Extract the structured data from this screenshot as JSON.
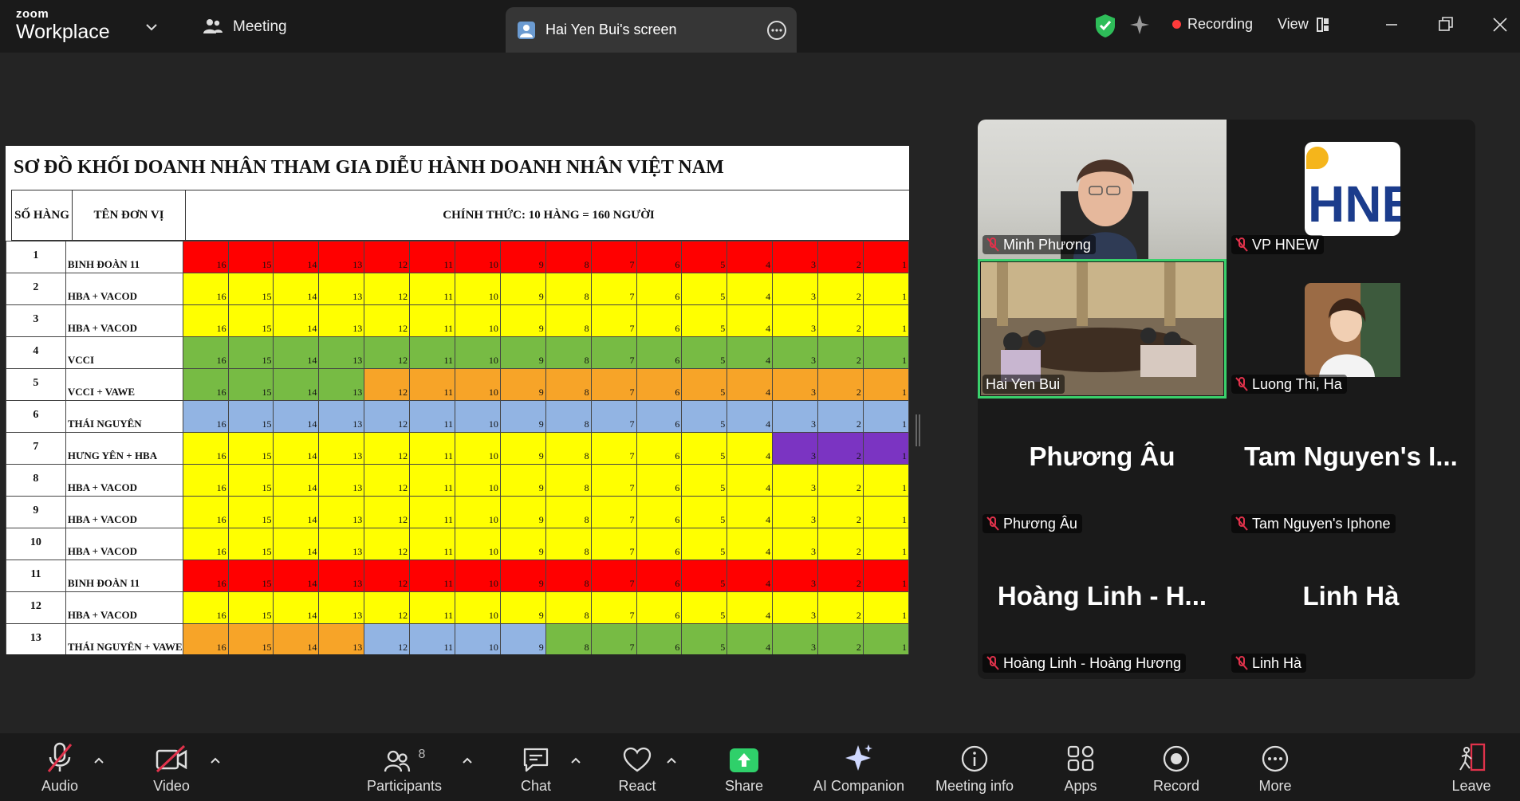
{
  "app": {
    "logo_line1": "zoom",
    "logo_line2": "Workplace"
  },
  "topbar": {
    "meeting_label": "Meeting",
    "share_tab_label": "Hai Yen Bui's screen",
    "recording_label": "Recording",
    "view_label": "View",
    "colors": {
      "bar": "#1a1a1a",
      "recording_dot": "#ff3b3b",
      "shield": "#2ebd59"
    }
  },
  "sheet": {
    "title": "SƠ ĐỒ KHỐI DOANH NHÂN THAM GIA DIỄU HÀNH DOANH NHÂN VIỆT NAM",
    "col_row_header": "SỐ HÀNG",
    "col_unit_header": "TÊN ĐƠN VỊ",
    "main_header": "CHÍNH THỨC: 10 HÀNG = 160 NGƯỜI",
    "palette": {
      "R": "#ff0000",
      "Y": "#ffff00",
      "G": "#77bb44",
      "O": "#f7a428",
      "B": "#92b4e3",
      "P": "#7b34c2"
    },
    "rows": [
      {
        "n": "1",
        "unit": "BINH ĐOÀN 11",
        "colors": "RRRRRRRRRRRRRRRR"
      },
      {
        "n": "2",
        "unit": "HBA + VACOD",
        "colors": "YYYYYYYYYYYYYYYY"
      },
      {
        "n": "3",
        "unit": "HBA + VACOD",
        "colors": "YYYYYYYYYYYYYYYY"
      },
      {
        "n": "4",
        "unit": "VCCI",
        "colors": "GGGGGGGGGGGGGGGG"
      },
      {
        "n": "5",
        "unit": "VCCI + VAWE",
        "colors": "GGGGOOOOOOOOOOOO"
      },
      {
        "n": "6",
        "unit": "THÁI NGUYÊN",
        "colors": "BBBBBBBBBBBBBBBB"
      },
      {
        "n": "7",
        "unit": "HƯNG YÊN + HBA",
        "colors": "YYYYYYYYYYYYYPPP"
      },
      {
        "n": "8",
        "unit": "HBA + VACOD",
        "colors": "YYYYYYYYYYYYYYYY"
      },
      {
        "n": "9",
        "unit": "HBA + VACOD",
        "colors": "YYYYYYYYYYYYYYYY"
      },
      {
        "n": "10",
        "unit": "HBA + VACOD",
        "colors": "YYYYYYYYYYYYYYYY"
      },
      {
        "n": "11",
        "unit": "BINH ĐOÀN 11",
        "colors": "RRRRRRRRRRRRRRRR"
      },
      {
        "n": "12",
        "unit": "HBA + VACOD",
        "colors": "YYYYYYYYYYYYYYYY"
      },
      {
        "n": "13",
        "unit": "THÁI NGUYÊN + VAWE",
        "colors": "OOOOBBBBGGGGGGGG"
      }
    ],
    "positions": [
      "16",
      "15",
      "14",
      "13",
      "12",
      "11",
      "10",
      "9",
      "8",
      "7",
      "6",
      "5",
      "4",
      "3",
      "2",
      "1"
    ]
  },
  "gallery": {
    "tiles": [
      {
        "name": "Minh Phương",
        "kind": "video-face"
      },
      {
        "name": "VP HNEW",
        "kind": "logo"
      },
      {
        "name": "Hai Yen Bui",
        "kind": "video-room"
      },
      {
        "name": "Luong Thi, Ha",
        "kind": "avatar"
      },
      {
        "name": "Phương Âu",
        "big": "Phương Âu"
      },
      {
        "name": "Tam Nguyen's Iphone",
        "big": "Tam  Nguyen's I..."
      },
      {
        "name": "Hoàng Linh - Hoàng Hương",
        "big": "Hoàng Linh - H..."
      },
      {
        "name": "Linh Hà",
        "big": "Linh Hà"
      }
    ]
  },
  "toolbar": {
    "audio": "Audio",
    "video": "Video",
    "participants": "Participants",
    "participants_count": "8",
    "chat": "Chat",
    "react": "React",
    "share": "Share",
    "ai_companion": "AI Companion",
    "meeting_info": "Meeting info",
    "apps": "Apps",
    "record": "Record",
    "more": "More",
    "leave": "Leave",
    "colors": {
      "share": "#2fd06a",
      "muted": "#e0324b"
    }
  }
}
